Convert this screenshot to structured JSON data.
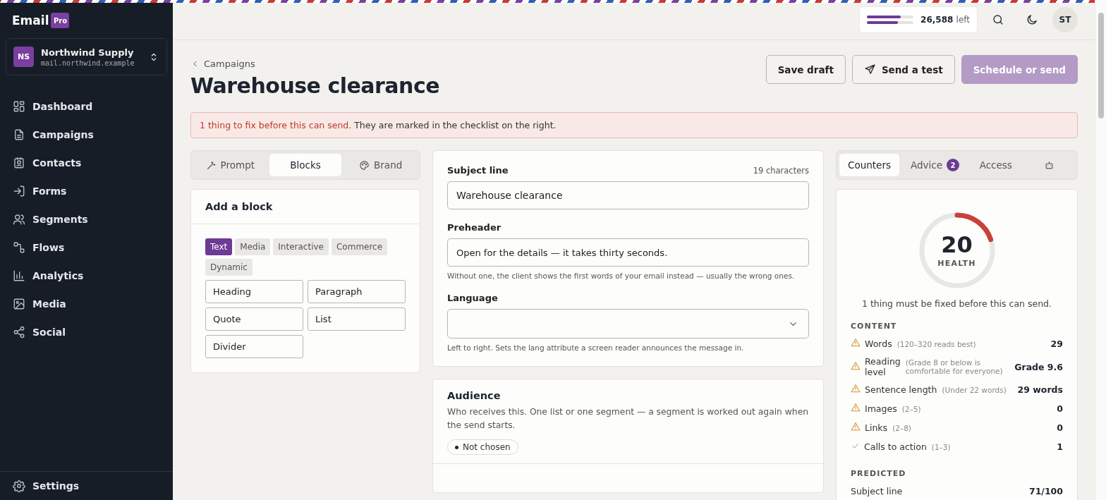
{
  "brand": {
    "name": "Email",
    "badge": "Pro"
  },
  "workspace": {
    "initials": "NS",
    "name": "Northwind Supply",
    "domain": "mail.northwind.example"
  },
  "nav": [
    {
      "label": "Dashboard"
    },
    {
      "label": "Campaigns"
    },
    {
      "label": "Contacts"
    },
    {
      "label": "Forms"
    },
    {
      "label": "Segments"
    },
    {
      "label": "Flows"
    },
    {
      "label": "Analytics"
    },
    {
      "label": "Media"
    },
    {
      "label": "Social"
    }
  ],
  "settings": {
    "label": "Settings"
  },
  "usage": {
    "bars": [
      {
        "level": 0.72
      },
      {
        "level": 0.67
      }
    ],
    "count": "26,588",
    "unit": "left"
  },
  "user": {
    "initials": "ST"
  },
  "breadcrumb": "Campaigns",
  "title": "Warehouse clearance",
  "actions": [
    {
      "label": "Save draft",
      "kind": "secondary",
      "disabled": false
    },
    {
      "label": "Send a test",
      "kind": "send",
      "disabled": false
    },
    {
      "label": "Schedule or send",
      "kind": "primary",
      "disabled": true
    }
  ],
  "alert": "**1 thing to fix before this can send.** They are marked in the checklist on the right.",
  "left_tabs": [
    {
      "label": "Prompt",
      "selected": false
    },
    {
      "label": "Blocks",
      "selected": true
    },
    {
      "label": "Brand",
      "selected": false
    }
  ],
  "add_block": {
    "title": "Add a block",
    "categories": [
      {
        "label": "Text",
        "selected": true
      },
      {
        "label": "Media",
        "selected": false
      },
      {
        "label": "Interactive",
        "selected": false
      },
      {
        "label": "Commerce",
        "selected": false
      },
      {
        "label": "Dynamic",
        "selected": false
      }
    ],
    "blocks": [
      "Heading",
      "Paragraph",
      "Quote",
      "List",
      "Divider"
    ]
  },
  "subject": {
    "label": "Subject line",
    "count": "19 characters",
    "value": "Warehouse clearance"
  },
  "preheader": {
    "label": "Preheader",
    "value": "Open for the details — it takes thirty seconds.",
    "hint": "Without one, the client shows the first words of your email instead — usually the wrong ones."
  },
  "language": {
    "label": "Language",
    "hint": "Left to right. Sets the lang attribute a screen reader announces the message in."
  },
  "audience": {
    "title": "Audience",
    "text": "Who receives this. One list or one segment — a segment is worked out again when the send starts.",
    "chip": "Not chosen"
  },
  "right_tabs": [
    {
      "kind": "text",
      "label": "Counters",
      "selected": true
    },
    {
      "kind": "text",
      "label": "Advice",
      "badge": "2",
      "selected": false
    },
    {
      "kind": "text",
      "label": "Access",
      "selected": false
    },
    {
      "kind": "icon",
      "selected": false
    }
  ],
  "health": {
    "score": "20",
    "label": "HEALTH",
    "summary": "1 thing must be fixed before this can send."
  },
  "content": {
    "heading": "CONTENT",
    "rows": [
      {
        "label": "Words",
        "hint": "(120–320 reads best)",
        "value": "29",
        "warning": true
      },
      {
        "label": "Reading level",
        "hint": "(Grade 8 or below is comfortable for everyone)",
        "value": "Grade 9.6",
        "warning": true
      },
      {
        "label": "Sentence length",
        "hint": "(Under 22 words)",
        "value": "29 words",
        "warning": true
      },
      {
        "label": "Images",
        "hint": "(2–5)",
        "value": "0",
        "warning": true
      },
      {
        "label": "Links",
        "hint": "(2–8)",
        "value": "0",
        "warning": true
      },
      {
        "label": "Calls to action",
        "hint": "(1–3)",
        "value": "1",
        "warning": false
      }
    ]
  },
  "predicted": {
    "heading": "PREDICTED",
    "rows": [
      {
        "label": "Subject line",
        "value": "71/100"
      }
    ]
  }
}
